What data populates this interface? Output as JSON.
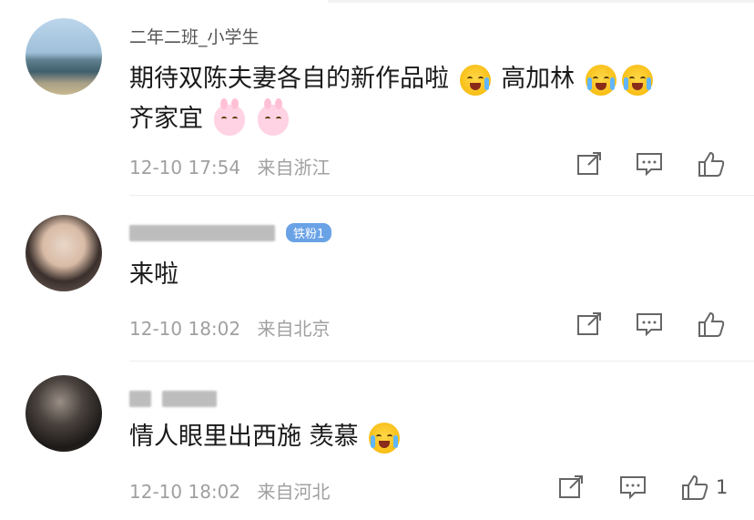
{
  "comments": [
    {
      "username": "二年二班_小学生",
      "text_parts": [
        "期待双陈夫妻各自的新作品啦",
        "高加林",
        "齐家宜"
      ],
      "time": "12-10 17:54",
      "location": "来自浙江",
      "likes": ""
    },
    {
      "username": "",
      "fan_badge": "铁粉1",
      "text": "来啦",
      "time": "12-10 18:02",
      "location": "来自北京",
      "likes": ""
    },
    {
      "username": "",
      "text": "情人眼里出西施 羡慕",
      "time": "12-10 18:02",
      "location": "来自河北",
      "likes": "1"
    }
  ],
  "icons": [
    "share-icon",
    "comment-icon",
    "like-icon"
  ],
  "colors": {
    "meta": "#a0a0a0",
    "text": "#1a1a1a",
    "badge": "#6aa2e6"
  }
}
